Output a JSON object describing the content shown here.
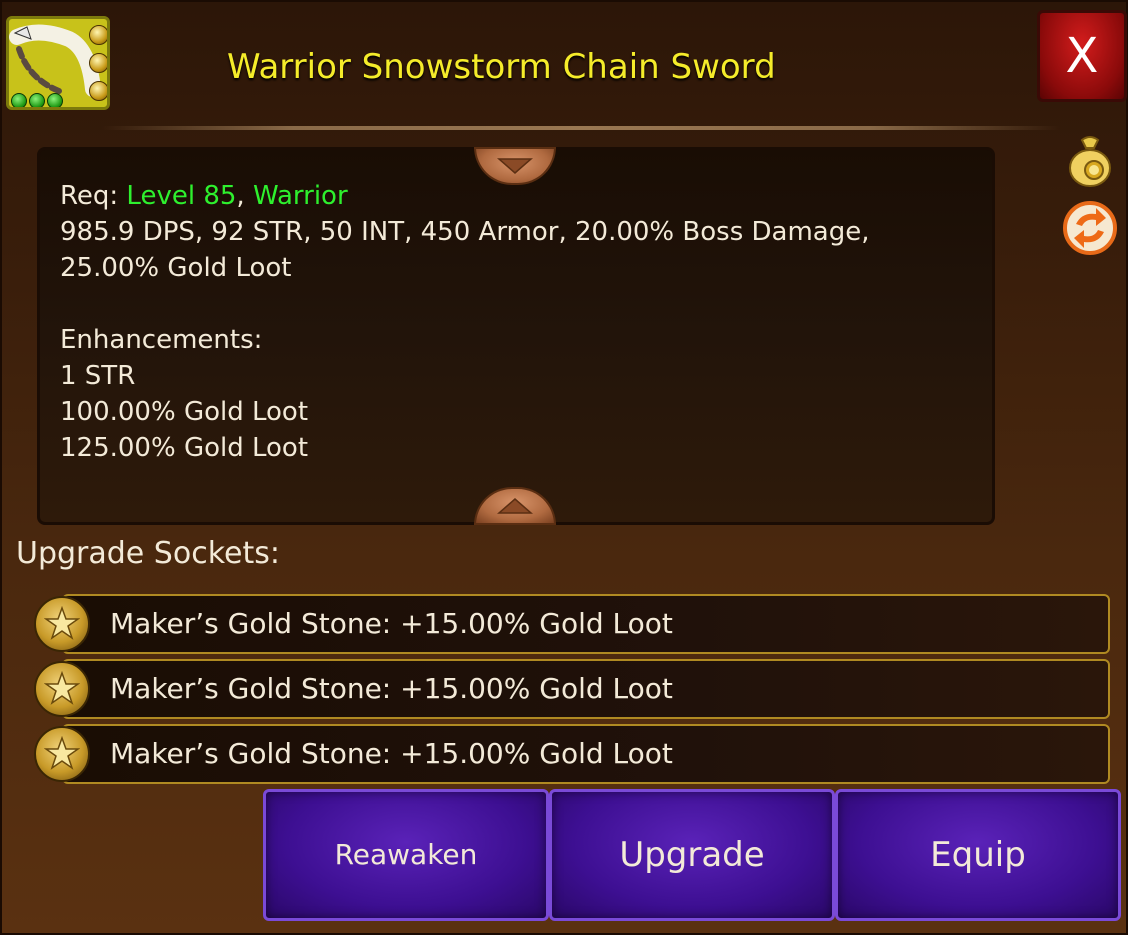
{
  "item": {
    "title": "Warrior Snowstorm Chain Sword",
    "icon": "chain-sword-icon",
    "socket_gems_shown": 3,
    "grade_dots": 3
  },
  "close_button": {
    "label": "X"
  },
  "description": {
    "req_prefix": "Req: ",
    "req_level": "Level 85",
    "req_separator": ", ",
    "req_class": "Warrior",
    "stats_line1": "985.9 DPS, 92 STR, 50 INT, 450 Armor, 20.00% Boss Damage,",
    "stats_line2": "25.00% Gold Loot",
    "enhancements_heading": "Enhancements:",
    "enhancements": [
      "1 STR",
      "100.00% Gold Loot",
      "125.00% Gold Loot"
    ]
  },
  "side_icons": [
    "loot-bag-icon",
    "swap-icon"
  ],
  "sockets": {
    "heading": "Upgrade Sockets:",
    "items": [
      {
        "label": "Maker’s Gold Stone: +15.00% Gold Loot"
      },
      {
        "label": "Maker’s Gold Stone: +15.00% Gold Loot"
      },
      {
        "label": "Maker’s Gold Stone: +15.00% Gold Loot"
      }
    ]
  },
  "actions": {
    "reawaken": "Reawaken",
    "upgrade": "Upgrade",
    "equip": "Equip"
  },
  "colors": {
    "title": "#f5ec2a",
    "requirement_met": "#2ef02e",
    "close_red": "#b01212",
    "button_purple": "#4a16a8",
    "socket_border": "#b08a22"
  }
}
